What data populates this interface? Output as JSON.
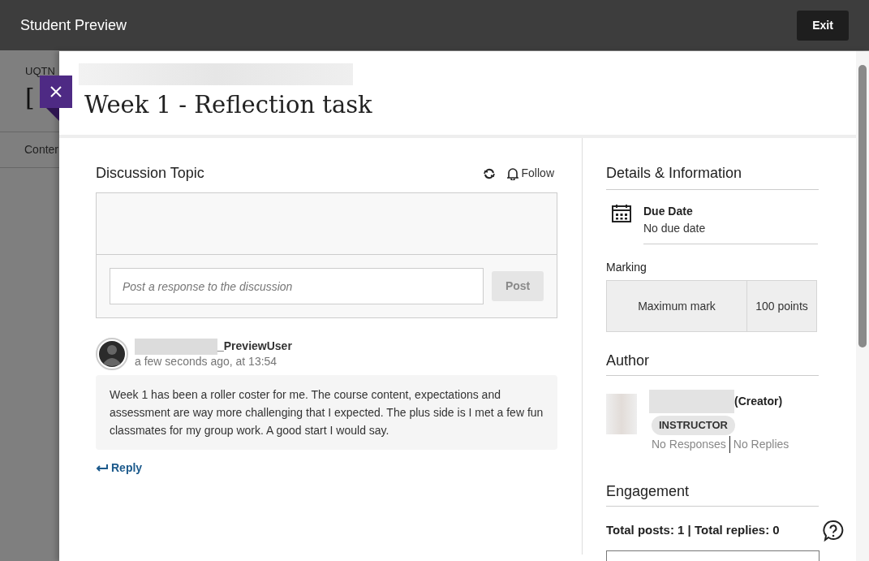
{
  "top_bar": {
    "title": "Student Preview",
    "exit_button": "Exit"
  },
  "background_page": {
    "course_code": "UQTN",
    "course_title": "[",
    "tab": "Conter"
  },
  "panel": {
    "title": "Week 1 - Reflection task",
    "discussion": {
      "heading": "Discussion Topic",
      "follow": "Follow",
      "response_field": {
        "placeholder": "Post a response to the discussion"
      },
      "post_button": {
        "label": "Post",
        "disabled": true
      }
    },
    "posts": [
      {
        "author": "_PreviewUser",
        "time": "a few seconds ago, at 13:54",
        "body": "Week 1 has been a roller coster for me. The course content, expectations and assessment are way more challenging that I expected. The plus side is I met a few fun classmates for my group work. A good start I would say.",
        "reply": "Reply"
      }
    ],
    "details": {
      "heading": "Details & Information",
      "due_label": "Due Date",
      "due_value": "No due date",
      "marking_label": "Marking",
      "marking": {
        "label": "Maximum mark",
        "value": "100 points"
      }
    },
    "author": {
      "heading": "Author",
      "role_suffix": "(Creator)",
      "badge": "INSTRUCTOR",
      "responses": "No Responses",
      "replies": "No Replies"
    },
    "engagement": {
      "heading": "Engagement",
      "totals": "Total posts: 1 | Total replies: 0"
    }
  }
}
